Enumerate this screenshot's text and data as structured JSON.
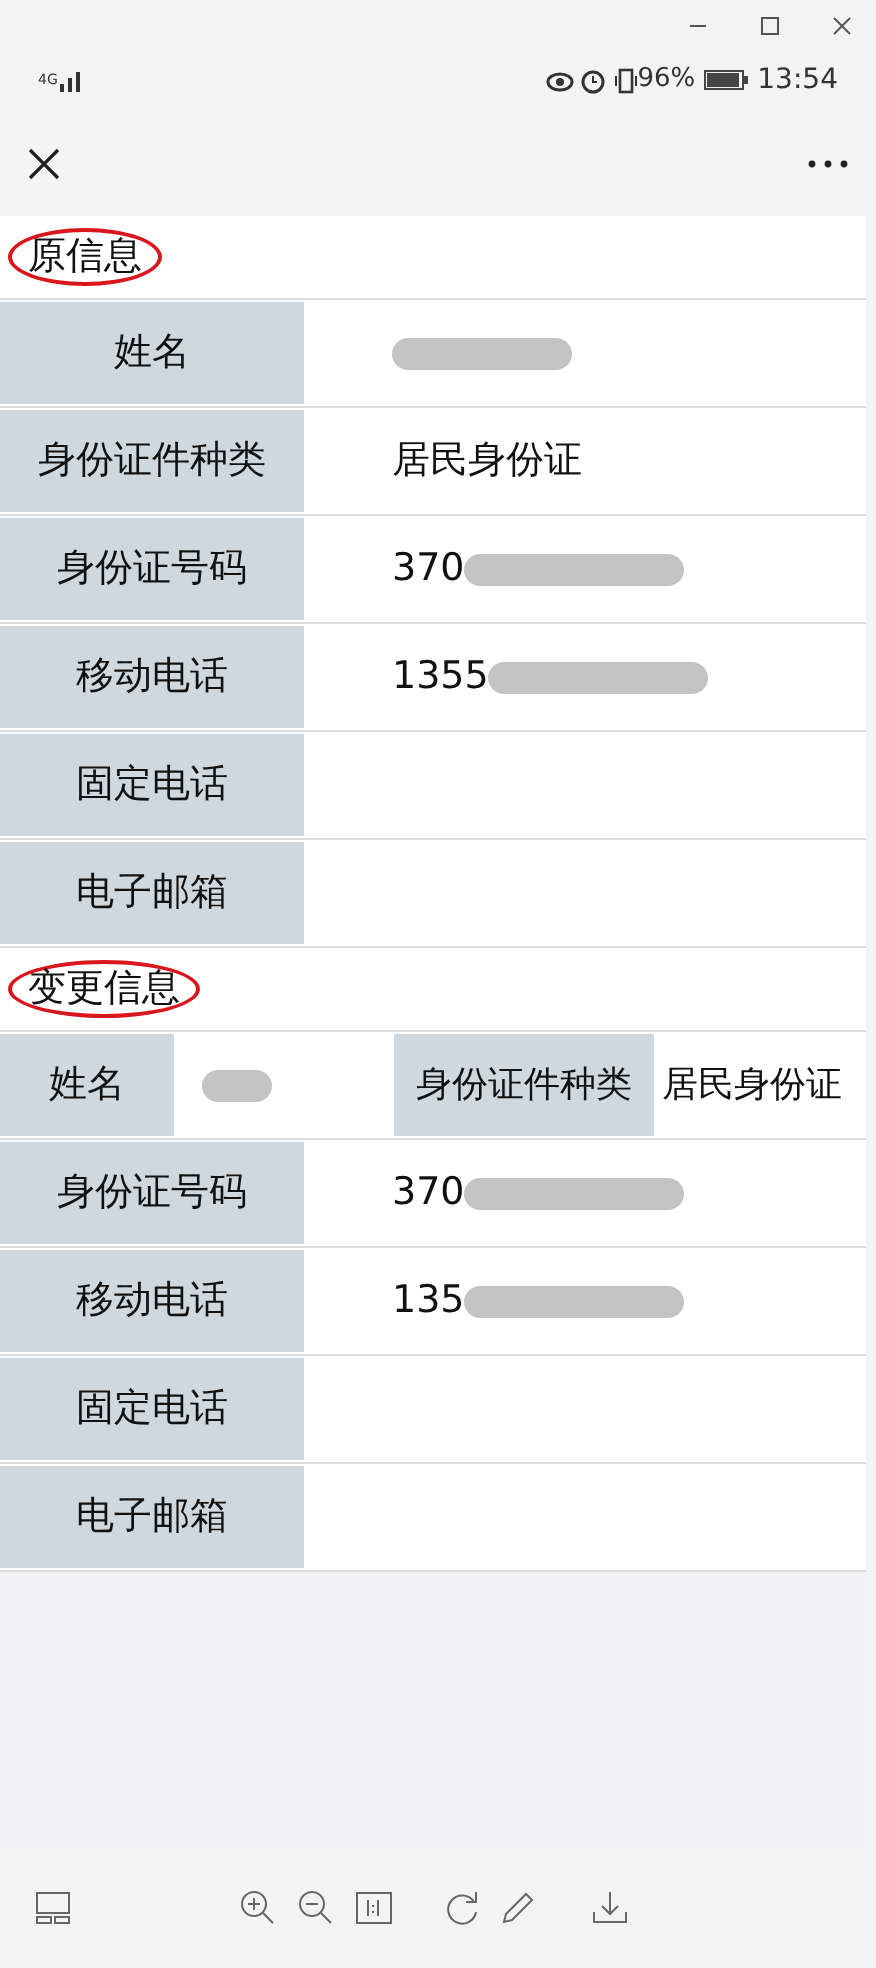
{
  "status_bar": {
    "network": "4G",
    "battery": "96%",
    "time": "13:54"
  },
  "sections": [
    {
      "title": "原信息",
      "rows": [
        {
          "kind": "single",
          "label": "姓名",
          "redacted": true
        },
        {
          "kind": "single",
          "label": "身份证件种类",
          "value": "居民身份证",
          "redacted": false
        },
        {
          "kind": "single",
          "label": "身份证号码",
          "value": "370",
          "redacted": true
        },
        {
          "kind": "single",
          "label": "移动电话",
          "value": "1355",
          "redacted": true
        },
        {
          "kind": "single",
          "label": "固定电话",
          "redacted": false
        },
        {
          "kind": "single",
          "label": "电子邮箱",
          "redacted": false
        }
      ]
    },
    {
      "title": "变更信息",
      "rows": [
        {
          "kind": "double",
          "label": "姓名",
          "redacted": true,
          "label_2": "身份证件种类",
          "value_2": "居民身份证"
        },
        {
          "kind": "single",
          "label": "身份证号码",
          "value": "370",
          "redacted": true
        },
        {
          "kind": "single",
          "label": "移动电话",
          "value": "135",
          "redacted": true
        },
        {
          "kind": "single",
          "label": "固定电话",
          "redacted": false
        },
        {
          "kind": "single",
          "label": "电子邮箱",
          "redacted": false
        }
      ]
    }
  ]
}
